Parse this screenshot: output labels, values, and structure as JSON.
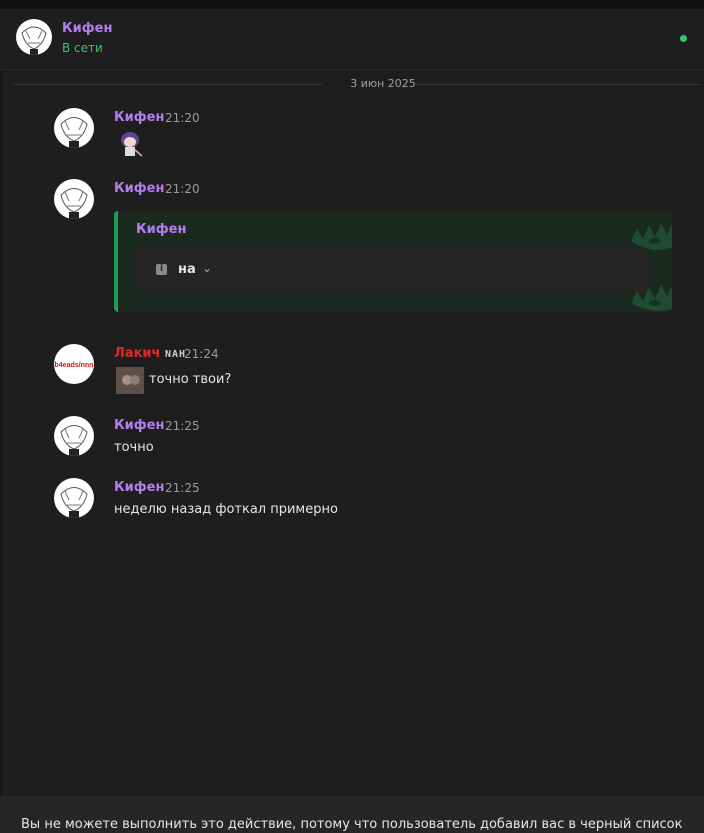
{
  "header": {
    "name": "Кифен",
    "status": "В сети"
  },
  "date_separator": "3 июн 2025",
  "messages": [
    {
      "author": "Кифен",
      "time": "21:20",
      "text": ""
    },
    {
      "author": "Кифен",
      "time": "21:20",
      "text": ""
    },
    {
      "author_red": "Лаки",
      "author_white": "ч",
      "author_badge": "NAH",
      "time": "21:24",
      "text": "точно твои?"
    },
    {
      "author": "Кифен",
      "time": "21:25",
      "text": "точно"
    },
    {
      "author": "Кифен",
      "time": "21:25",
      "text": "неделю назад фоткал примерно"
    }
  ],
  "embed": {
    "author": "Кифен",
    "field_label": "на"
  },
  "avatar_text": "b4eads/nnn",
  "notice": "Вы не можете выполнить это действие, потому что пользователь добавил вас в черный список",
  "colors": {
    "background": "#1e1e1e",
    "author": "#b57cf0",
    "online": "#2ecc71",
    "embed_accent": "#1f9d55",
    "red_name": "#e02b2b"
  }
}
